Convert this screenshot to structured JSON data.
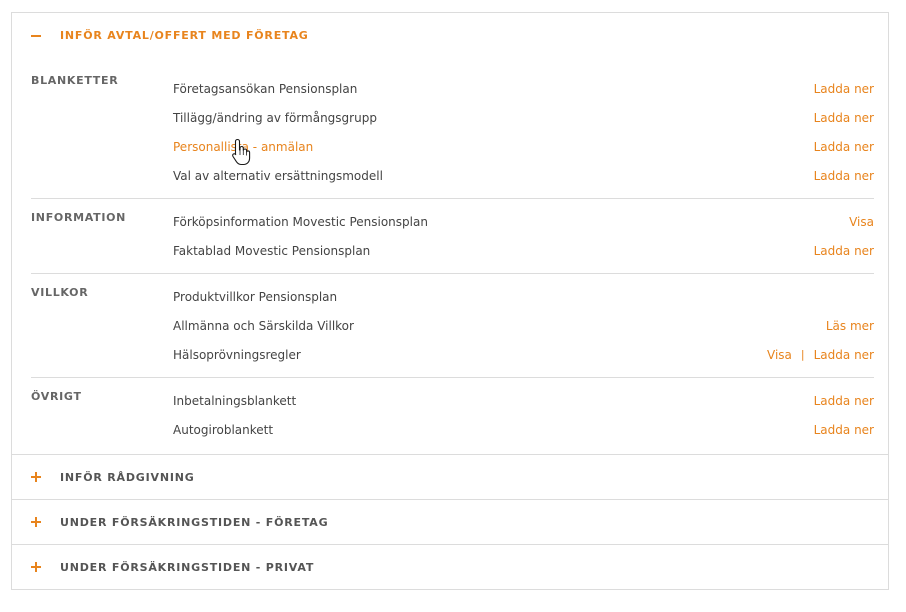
{
  "colors": {
    "accent": "#e8841d",
    "text": "#444444",
    "label": "#666666",
    "border": "#dcdcdc"
  },
  "sections": [
    {
      "title": "INFÖR AVTAL/OFFERT MED FÖRETAG",
      "icon": "minus-icon",
      "expanded": true,
      "groups": [
        {
          "label": "BLANKETTER",
          "rows": [
            {
              "name": "Företagsansökan Pensionsplan",
              "actions": [
                "Ladda ner"
              ]
            },
            {
              "name": "Tillägg/ändring av förmångsgrupp",
              "actions": [
                "Ladda ner"
              ]
            },
            {
              "name": "Personallista - anmälan",
              "actions": [
                "Ladda ner"
              ],
              "hover": true
            },
            {
              "name": "Val av alternativ ersättningsmodell",
              "actions": [
                "Ladda ner"
              ]
            }
          ]
        },
        {
          "label": "INFORMATION",
          "rows": [
            {
              "name": "Förköpsinformation Movestic Pensionsplan",
              "actions": [
                "Visa"
              ]
            },
            {
              "name": "Faktablad Movestic Pensionsplan",
              "actions": [
                "Ladda ner"
              ]
            }
          ]
        },
        {
          "label": "VILLKOR",
          "rows": [
            {
              "name": "Produktvillkor Pensionsplan",
              "actions": []
            },
            {
              "name": "Allmänna och Särskilda Villkor",
              "actions": [
                "Läs mer"
              ]
            },
            {
              "name": "Hälsoprövningsregler",
              "actions": [
                "Visa",
                "Ladda ner"
              ]
            }
          ]
        },
        {
          "label": "ÖVRIGT",
          "rows": [
            {
              "name": "Inbetalningsblankett",
              "actions": [
                "Ladda ner"
              ]
            },
            {
              "name": "Autogiroblankett",
              "actions": [
                "Ladda ner"
              ]
            }
          ]
        }
      ]
    },
    {
      "title": "INFÖR RÅDGIVNING",
      "icon": "plus-icon",
      "expanded": false
    },
    {
      "title": "UNDER FÖRSÄKRINGSTIDEN - FÖRETAG",
      "icon": "plus-icon",
      "expanded": false
    },
    {
      "title": "UNDER FÖRSÄKRINGSTIDEN - PRIVAT",
      "icon": "plus-icon",
      "expanded": false
    }
  ],
  "action_separator": "|",
  "cursor": "hand-pointer-cursor"
}
